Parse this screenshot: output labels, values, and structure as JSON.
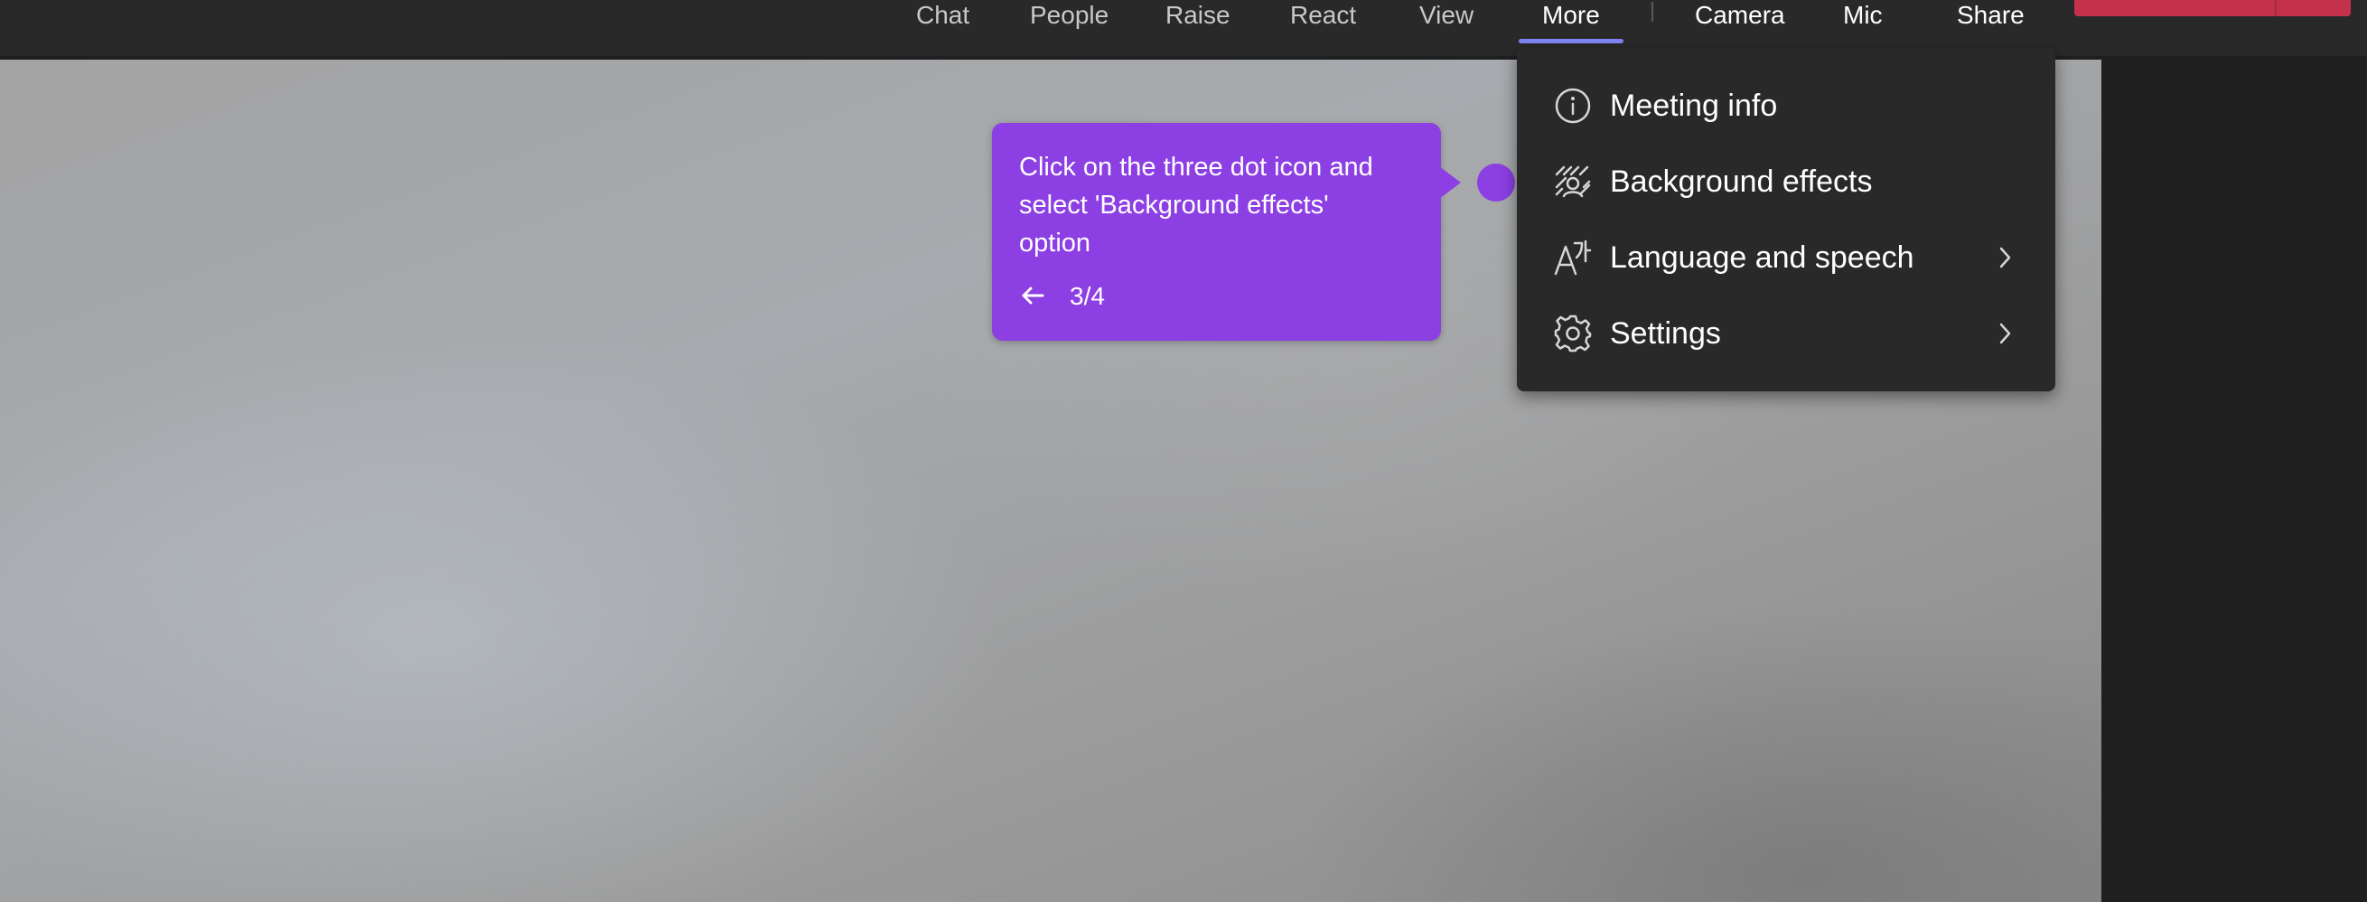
{
  "toolbar": {
    "chat": "Chat",
    "people": "People",
    "raise": "Raise",
    "react": "React",
    "view": "View",
    "more": "More",
    "camera": "Camera",
    "mic": "Mic",
    "share": "Share"
  },
  "more_menu": {
    "items": [
      {
        "label": "Meeting info",
        "icon": "info-icon",
        "submenu": false
      },
      {
        "label": "Background effects",
        "icon": "background-effects-icon",
        "submenu": false
      },
      {
        "label": "Language and speech",
        "icon": "language-icon",
        "submenu": true
      },
      {
        "label": "Settings",
        "icon": "gear-icon",
        "submenu": true
      }
    ]
  },
  "tooltip": {
    "text": "Click on the three dot icon and select 'Background effects' option",
    "step": "3/4"
  },
  "colors": {
    "accent_purple": "#8c3fe3",
    "underline": "#7f85f5",
    "leave_red": "#c4314b",
    "menu_bg": "#292929"
  }
}
